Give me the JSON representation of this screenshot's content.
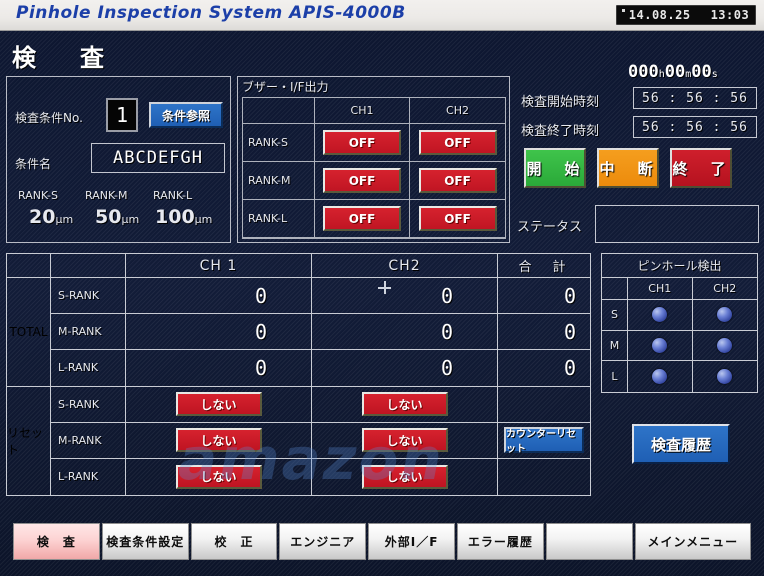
{
  "titlebar": {
    "app_title": "Pinhole Inspection System APIS-4000B",
    "clock_date": "14.08.25",
    "clock_time": "13:03"
  },
  "page": {
    "title": "検　査"
  },
  "condition_panel": {
    "cond_no_label": "検査条件No.",
    "cond_no_value": "1",
    "cond_ref_button": "条件参照",
    "cond_name_label": "条件名",
    "cond_name_value": "ABCDEFGH",
    "ranks": [
      {
        "head": "RANK-S",
        "value": "20",
        "unit": "μm"
      },
      {
        "head": "RANK-M",
        "value": "50",
        "unit": "μm"
      },
      {
        "head": "RANK-L",
        "value": "100",
        "unit": "μm"
      }
    ]
  },
  "buzzer_panel": {
    "title": "ブザー・I/F出力",
    "columns": [
      "CH1",
      "CH2"
    ],
    "rows": [
      {
        "rank": "RANK-S",
        "ch1": "OFF",
        "ch2": "OFF"
      },
      {
        "rank": "RANK-M",
        "ch1": "OFF",
        "ch2": "OFF"
      },
      {
        "rank": "RANK-L",
        "ch1": "OFF",
        "ch2": "OFF"
      }
    ]
  },
  "control_panel": {
    "elapsed_hours": "000",
    "elapsed_h_unit": "h",
    "elapsed_minutes": "00",
    "elapsed_m_unit": "m",
    "elapsed_seconds": "00",
    "elapsed_s_unit": "s",
    "start_time_label": "検査開始時刻",
    "start_time_value": "56  :  56  :  56",
    "end_time_label": "検査終了時刻",
    "end_time_value": "56  :  56  :  56",
    "button_start": "開　始",
    "button_pause": "中　断",
    "button_stop": "終　了",
    "status_label": "ステータス",
    "status_value": ""
  },
  "main_table": {
    "headers": {
      "blank1": "",
      "blank2": "",
      "ch1": "CH 1",
      "ch2": "CH2",
      "total": "合　計"
    },
    "total_group_label": "TOTAL",
    "reset_group_label": "リセット",
    "total_rows": [
      {
        "rank": "S-RANK",
        "ch1": "0",
        "ch2": "0",
        "total": "0"
      },
      {
        "rank": "M-RANK",
        "ch1": "0",
        "ch2": "0",
        "total": "0"
      },
      {
        "rank": "L-RANK",
        "ch1": "0",
        "ch2": "0",
        "total": "0"
      }
    ],
    "reset_rows": [
      {
        "rank": "S-RANK",
        "ch1": "しない",
        "ch2": "しない",
        "total": ""
      },
      {
        "rank": "M-RANK",
        "ch1": "しない",
        "ch2": "しない",
        "total": "カウンターリセット"
      },
      {
        "rank": "L-RANK",
        "ch1": "しない",
        "ch2": "しない",
        "total": ""
      }
    ],
    "counter_reset_button": "カウンターリセット"
  },
  "pinhole_panel": {
    "title": "ピンホール検出",
    "columns": [
      "CH1",
      "CH2"
    ],
    "rows": [
      {
        "rank": "S",
        "ch1_lamp": "lamp-off",
        "ch2_lamp": "lamp-off"
      },
      {
        "rank": "M",
        "ch1_lamp": "lamp-off",
        "ch2_lamp": "lamp-off"
      },
      {
        "rank": "L",
        "ch1_lamp": "lamp-off",
        "ch2_lamp": "lamp-off"
      }
    ]
  },
  "history_button": "検査履歴",
  "watermark": "amazon",
  "tabbar": {
    "tabs": [
      {
        "label": "検　査",
        "active": true
      },
      {
        "label": "検査条件設定",
        "active": false
      },
      {
        "label": "校　正",
        "active": false
      },
      {
        "label": "エンジニア",
        "active": false
      },
      {
        "label": "外部I／F",
        "active": false
      },
      {
        "label": "エラー履歴",
        "active": false
      },
      {
        "label": "",
        "active": false
      },
      {
        "label": "メインメニュー",
        "active": false
      }
    ]
  },
  "colors": {
    "background": "#101a33",
    "accent_blue": "#2e74c8",
    "button_red": "#c01523",
    "button_green": "#2aa939",
    "button_orange": "#ec8b0c",
    "title_text": "#1c3fa8",
    "grid_line": "#c9ccd4",
    "active_tab": "#f0a8a8"
  }
}
